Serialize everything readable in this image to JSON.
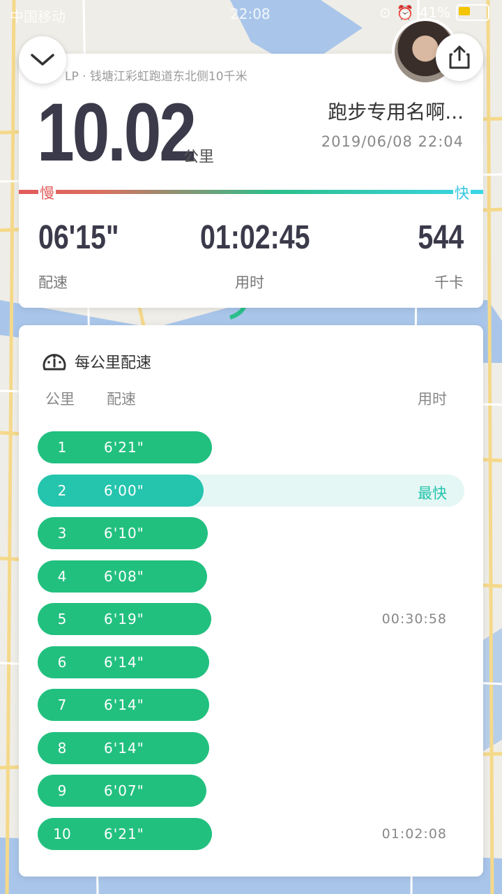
{
  "status_bar": {
    "carrier": "中国移动",
    "time": "22:08",
    "battery": "41%"
  },
  "header": {
    "route": "LP · 钱塘江彩虹跑道东北侧10千米",
    "distance": "10.02",
    "distance_unit": "公里",
    "run_name": "跑步专用名啊...",
    "datetime": "2019/06/08 22:04",
    "slow_label": "慢",
    "fast_label": "快"
  },
  "stats": [
    {
      "value": "06'15\"",
      "label": "配速"
    },
    {
      "value": "01:02:45",
      "label": "用时"
    },
    {
      "value": "544",
      "label": "千卡"
    }
  ],
  "splits": {
    "title": "每公里配速",
    "col_km": "公里",
    "col_pace": "配速",
    "col_time": "用时",
    "fastest_label": "最快",
    "rows": [
      {
        "km": "1",
        "pace": "6'21\"",
        "time": ""
      },
      {
        "km": "2",
        "pace": "6'00\"",
        "time": ""
      },
      {
        "km": "3",
        "pace": "6'10\"",
        "time": ""
      },
      {
        "km": "4",
        "pace": "6'08\"",
        "time": ""
      },
      {
        "km": "5",
        "pace": "6'19\"",
        "time": "00:30:58"
      },
      {
        "km": "6",
        "pace": "6'14\"",
        "time": ""
      },
      {
        "km": "7",
        "pace": "6'14\"",
        "time": ""
      },
      {
        "km": "8",
        "pace": "6'14\"",
        "time": ""
      },
      {
        "km": "9",
        "pace": "6'07\"",
        "time": ""
      },
      {
        "km": "10",
        "pace": "6'21\"",
        "time": "01:02:08"
      }
    ]
  },
  "icons": {
    "collapse": "chevron-down-icon",
    "share": "share-icon",
    "gauge": "speedometer-icon"
  },
  "colors": {
    "pace_bar": "#22c07f",
    "fastest_bar": "#24c4ad",
    "slow": "#e05a5a",
    "fast": "#35c7e0"
  }
}
